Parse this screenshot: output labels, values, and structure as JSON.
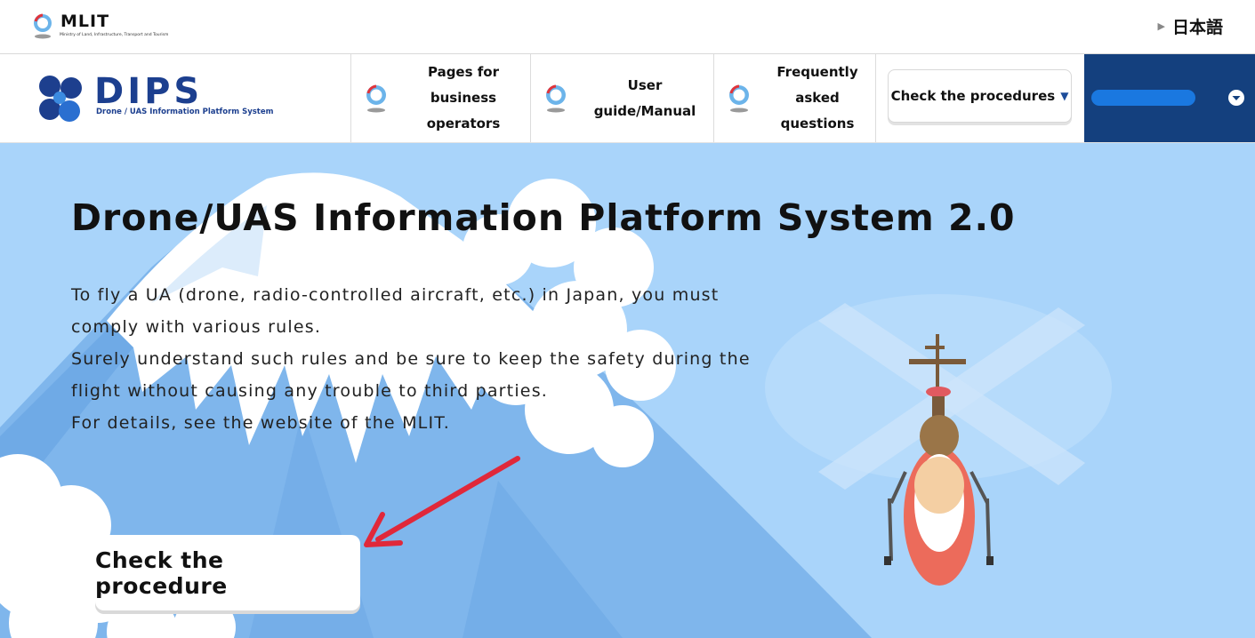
{
  "topbar": {
    "logo_text": "MLIT",
    "logo_subtitle": "Ministry of Land, Infrastructure, Transport and Tourism",
    "language_link": "日本語"
  },
  "navbar": {
    "logo_text": "DIPS",
    "logo_subtitle": "Drone / UAS Information Platform System",
    "items": [
      {
        "label_line1": "Pages for business",
        "label_line2": "operators",
        "icon": "mlit-emblem-icon"
      },
      {
        "label_line1": "User guide/Manual",
        "label_line2": "",
        "icon": "mlit-emblem-icon"
      },
      {
        "label_line1": "Frequently",
        "label_line2": "asked questions",
        "icon": "mlit-emblem-icon"
      }
    ],
    "check_procedures": "Check the procedures",
    "user_panel": {
      "user_name": "",
      "icon": "chevron-down-circle-icon"
    }
  },
  "hero": {
    "title": "Drone/UAS Information Platform System 2.0",
    "paragraph_lines": [
      "To fly a UA (drone, radio-controlled aircraft, etc.) in Japan, you must",
      "comply with various rules.",
      "Surely understand such rules and be sure to keep the safety during the",
      "flight without causing any trouble to third parties.",
      "For details, see the website of the MLIT."
    ],
    "cta_button": "Check the procedure"
  },
  "colors": {
    "navy": "#14407e",
    "brand_blue": "#1c3f8f",
    "sky": "#a9d4fa",
    "annotation_arrow": "#e0283a"
  }
}
